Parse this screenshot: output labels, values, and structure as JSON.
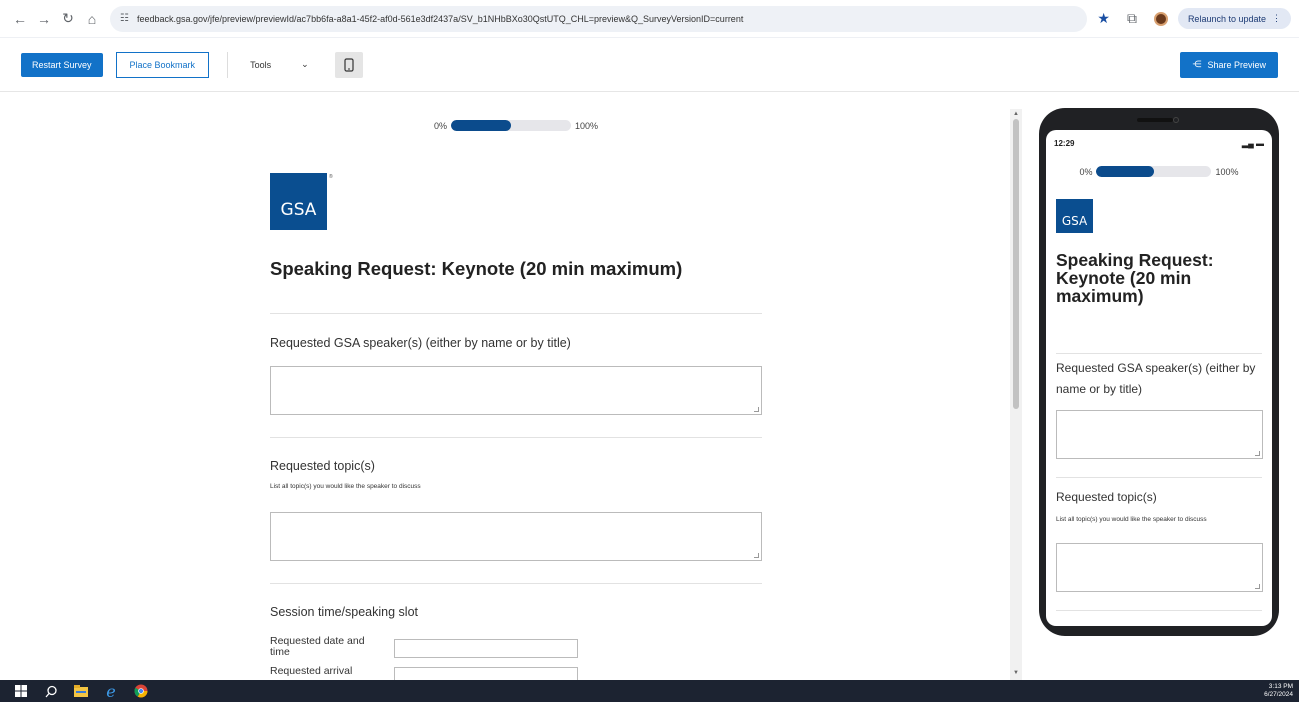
{
  "browser": {
    "url": "feedback.gsa.gov/jfe/preview/previewId/ac7bb6fa-a8a1-45f2-af0d-561e3df2437a/SV_b1NHbBXo30QstUTQ_CHL=preview&Q_SurveyVersionID=current",
    "relaunch_label": "Relaunch to update"
  },
  "toolbar": {
    "restart_label": "Restart Survey",
    "bookmark_label": "Place Bookmark",
    "tools_label": "Tools",
    "share_label": "Share Preview"
  },
  "survey": {
    "progress_start": "0%",
    "progress_end": "100%",
    "progress_fraction": 0.5,
    "logo_text": "GSA",
    "title": "Speaking Request: Keynote (20 min maximum)",
    "q1_label": "Requested GSA speaker(s) (either by name or by title)",
    "q2_label": "Requested topic(s)",
    "q2_desc": "List all topic(s) you would like the speaker to discuss",
    "q3_label": "Session time/speaking slot",
    "field1_label": "Requested date and time",
    "field2_label": "Requested arrival"
  },
  "phone": {
    "time": "12:29"
  },
  "taskbar": {
    "time": "3:13 PM",
    "date": "6/27/2024"
  },
  "colors": {
    "accent": "#1272c8",
    "progress": "#0b4b8c",
    "logo": "#0a4e90",
    "taskbar": "#1c2331"
  }
}
